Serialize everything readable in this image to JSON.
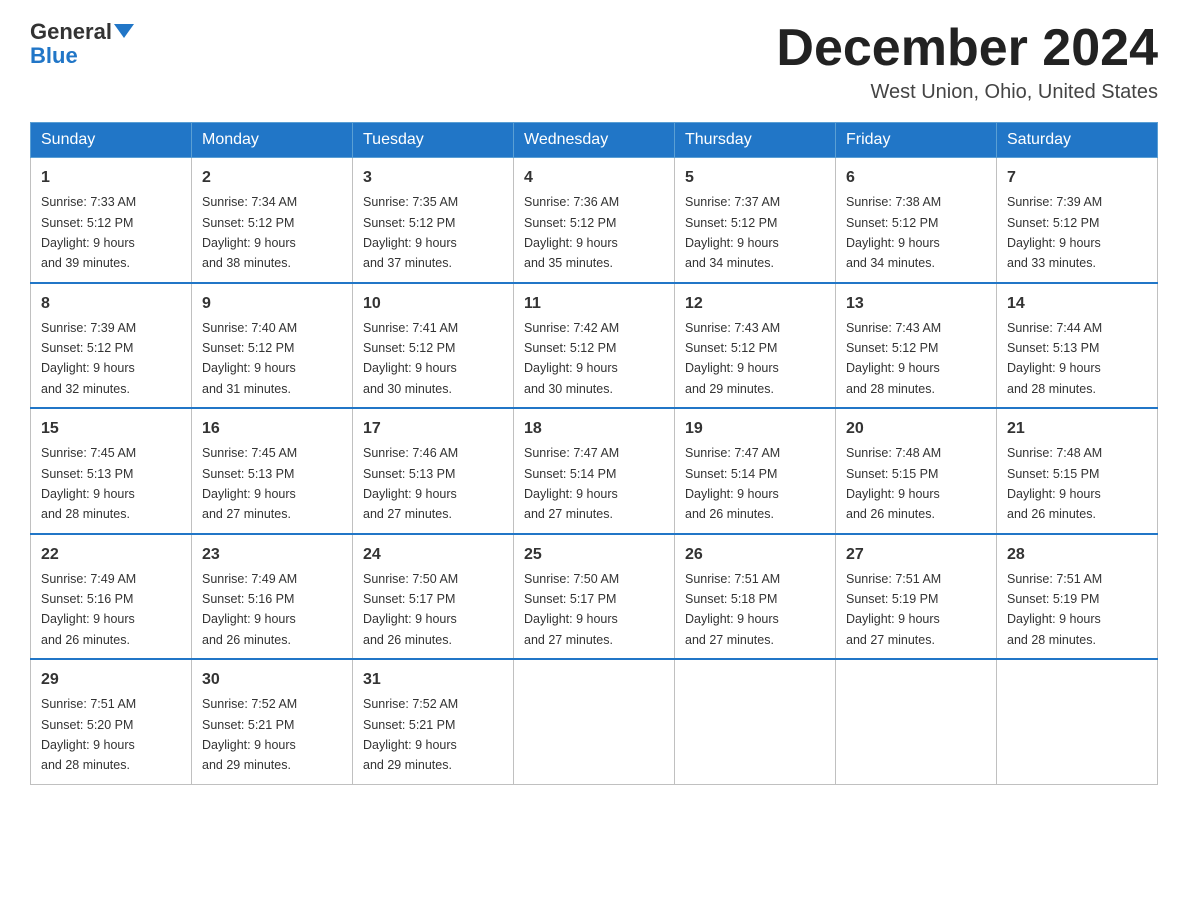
{
  "logo": {
    "text_general": "General",
    "text_blue": "Blue",
    "tagline": ""
  },
  "calendar": {
    "title": "December 2024",
    "subtitle": "West Union, Ohio, United States",
    "days_of_week": [
      "Sunday",
      "Monday",
      "Tuesday",
      "Wednesday",
      "Thursday",
      "Friday",
      "Saturday"
    ],
    "weeks": [
      [
        {
          "day": "1",
          "sunrise": "7:33 AM",
          "sunset": "5:12 PM",
          "daylight": "9 hours and 39 minutes."
        },
        {
          "day": "2",
          "sunrise": "7:34 AM",
          "sunset": "5:12 PM",
          "daylight": "9 hours and 38 minutes."
        },
        {
          "day": "3",
          "sunrise": "7:35 AM",
          "sunset": "5:12 PM",
          "daylight": "9 hours and 37 minutes."
        },
        {
          "day": "4",
          "sunrise": "7:36 AM",
          "sunset": "5:12 PM",
          "daylight": "9 hours and 35 minutes."
        },
        {
          "day": "5",
          "sunrise": "7:37 AM",
          "sunset": "5:12 PM",
          "daylight": "9 hours and 34 minutes."
        },
        {
          "day": "6",
          "sunrise": "7:38 AM",
          "sunset": "5:12 PM",
          "daylight": "9 hours and 34 minutes."
        },
        {
          "day": "7",
          "sunrise": "7:39 AM",
          "sunset": "5:12 PM",
          "daylight": "9 hours and 33 minutes."
        }
      ],
      [
        {
          "day": "8",
          "sunrise": "7:39 AM",
          "sunset": "5:12 PM",
          "daylight": "9 hours and 32 minutes."
        },
        {
          "day": "9",
          "sunrise": "7:40 AM",
          "sunset": "5:12 PM",
          "daylight": "9 hours and 31 minutes."
        },
        {
          "day": "10",
          "sunrise": "7:41 AM",
          "sunset": "5:12 PM",
          "daylight": "9 hours and 30 minutes."
        },
        {
          "day": "11",
          "sunrise": "7:42 AM",
          "sunset": "5:12 PM",
          "daylight": "9 hours and 30 minutes."
        },
        {
          "day": "12",
          "sunrise": "7:43 AM",
          "sunset": "5:12 PM",
          "daylight": "9 hours and 29 minutes."
        },
        {
          "day": "13",
          "sunrise": "7:43 AM",
          "sunset": "5:12 PM",
          "daylight": "9 hours and 28 minutes."
        },
        {
          "day": "14",
          "sunrise": "7:44 AM",
          "sunset": "5:13 PM",
          "daylight": "9 hours and 28 minutes."
        }
      ],
      [
        {
          "day": "15",
          "sunrise": "7:45 AM",
          "sunset": "5:13 PM",
          "daylight": "9 hours and 28 minutes."
        },
        {
          "day": "16",
          "sunrise": "7:45 AM",
          "sunset": "5:13 PM",
          "daylight": "9 hours and 27 minutes."
        },
        {
          "day": "17",
          "sunrise": "7:46 AM",
          "sunset": "5:13 PM",
          "daylight": "9 hours and 27 minutes."
        },
        {
          "day": "18",
          "sunrise": "7:47 AM",
          "sunset": "5:14 PM",
          "daylight": "9 hours and 27 minutes."
        },
        {
          "day": "19",
          "sunrise": "7:47 AM",
          "sunset": "5:14 PM",
          "daylight": "9 hours and 26 minutes."
        },
        {
          "day": "20",
          "sunrise": "7:48 AM",
          "sunset": "5:15 PM",
          "daylight": "9 hours and 26 minutes."
        },
        {
          "day": "21",
          "sunrise": "7:48 AM",
          "sunset": "5:15 PM",
          "daylight": "9 hours and 26 minutes."
        }
      ],
      [
        {
          "day": "22",
          "sunrise": "7:49 AM",
          "sunset": "5:16 PM",
          "daylight": "9 hours and 26 minutes."
        },
        {
          "day": "23",
          "sunrise": "7:49 AM",
          "sunset": "5:16 PM",
          "daylight": "9 hours and 26 minutes."
        },
        {
          "day": "24",
          "sunrise": "7:50 AM",
          "sunset": "5:17 PM",
          "daylight": "9 hours and 26 minutes."
        },
        {
          "day": "25",
          "sunrise": "7:50 AM",
          "sunset": "5:17 PM",
          "daylight": "9 hours and 27 minutes."
        },
        {
          "day": "26",
          "sunrise": "7:51 AM",
          "sunset": "5:18 PM",
          "daylight": "9 hours and 27 minutes."
        },
        {
          "day": "27",
          "sunrise": "7:51 AM",
          "sunset": "5:19 PM",
          "daylight": "9 hours and 27 minutes."
        },
        {
          "day": "28",
          "sunrise": "7:51 AM",
          "sunset": "5:19 PM",
          "daylight": "9 hours and 28 minutes."
        }
      ],
      [
        {
          "day": "29",
          "sunrise": "7:51 AM",
          "sunset": "5:20 PM",
          "daylight": "9 hours and 28 minutes."
        },
        {
          "day": "30",
          "sunrise": "7:52 AM",
          "sunset": "5:21 PM",
          "daylight": "9 hours and 29 minutes."
        },
        {
          "day": "31",
          "sunrise": "7:52 AM",
          "sunset": "5:21 PM",
          "daylight": "9 hours and 29 minutes."
        },
        null,
        null,
        null,
        null
      ]
    ],
    "label_sunrise": "Sunrise:",
    "label_sunset": "Sunset:",
    "label_daylight": "Daylight:"
  }
}
